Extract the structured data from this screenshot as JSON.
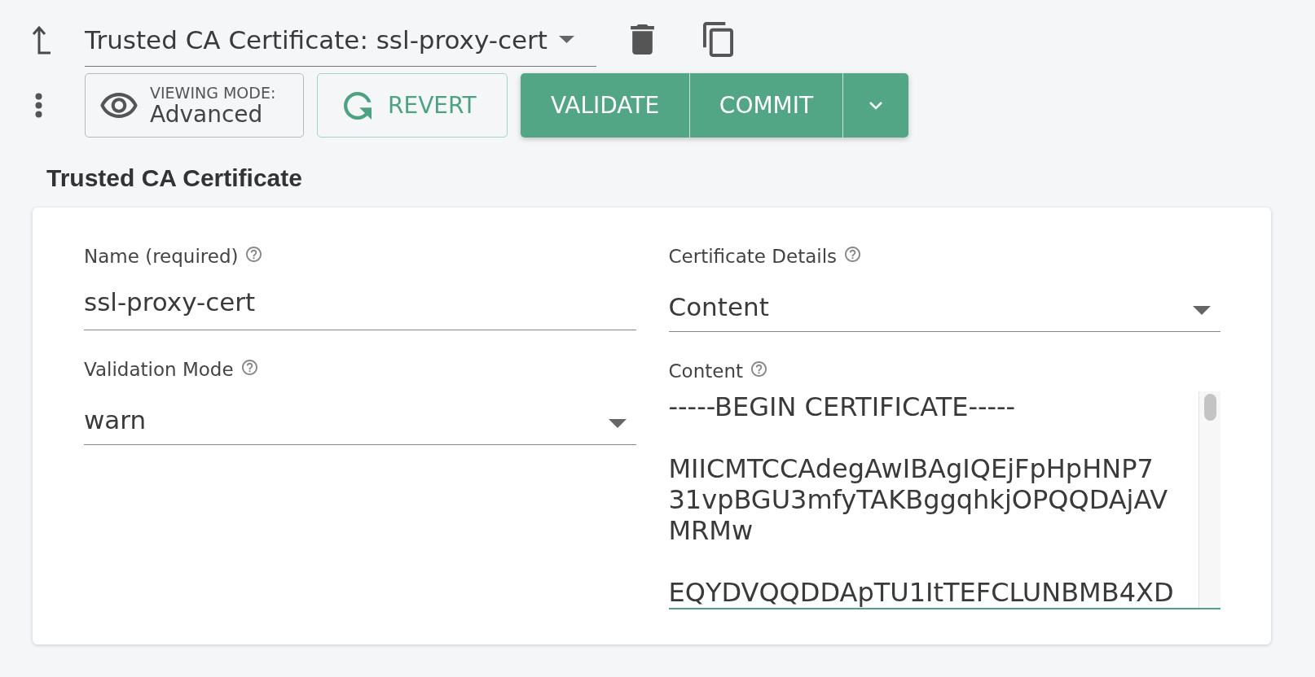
{
  "header": {
    "title_dropdown": {
      "value": "Trusted CA Certificate: ssl-proxy-cert"
    }
  },
  "toolbar": {
    "viewing_mode": {
      "label": "VIEWING MODE:",
      "value": "Advanced"
    },
    "revert": {
      "label": "REVERT"
    },
    "actions": [
      {
        "label": "VALIDATE"
      },
      {
        "label": "COMMIT"
      }
    ]
  },
  "section": {
    "title": "Trusted CA Certificate"
  },
  "form": {
    "columns": [
      {
        "fields": [
          {
            "kind": "text",
            "label": "Name (required)",
            "value": "ssl-proxy-cert",
            "focused": false
          },
          {
            "kind": "select",
            "label": "Validation Mode",
            "value": "warn",
            "focused": false
          }
        ]
      },
      {
        "fields": [
          {
            "kind": "select",
            "label": "Certificate Details",
            "value": "Content",
            "focused": false
          },
          {
            "kind": "textarea",
            "label": "Content",
            "paragraphs": [
              [
                "-----BEGIN CERTIFICATE-----"
              ],
              [
                "MIICMTCCAdegAwIBAgIQEjFpHpHNP7",
                "31vpBGU3mfyTAKBggqhkjOPQQDAjAV",
                "MRMw"
              ],
              [
                "EQYDVQQDDApTU1ItTEFCLUNBMB4XD"
              ]
            ],
            "focused": true
          }
        ]
      }
    ]
  }
}
